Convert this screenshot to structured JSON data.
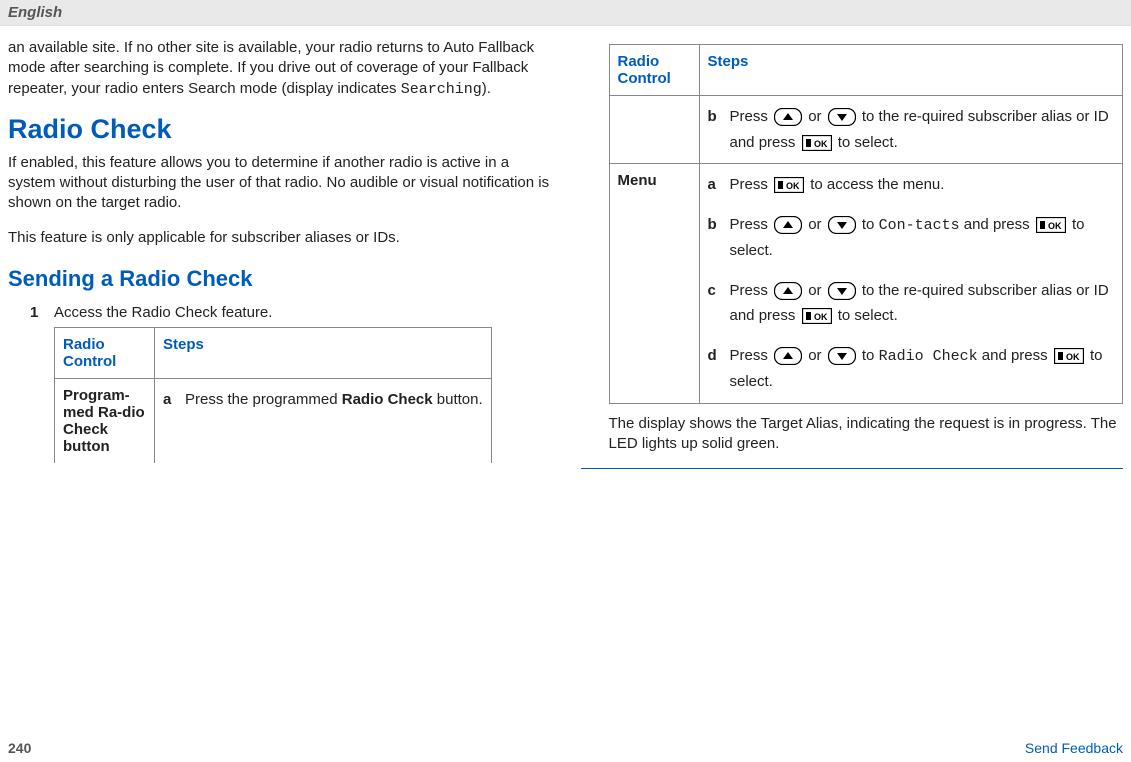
{
  "header": {
    "language": "English"
  },
  "colLeft": {
    "introPara": "an available site. If no other site is available, your radio returns to Auto Fallback mode after searching is complete. If you drive out of coverage of your Fallback repeater, your radio enters Search mode (display indicates ",
    "introMono": "Searching",
    "introClose": ").",
    "h1": "Radio Check",
    "para1": "If enabled, this feature allows you to determine if another radio is active in a system without disturbing the user of that radio. No audible or visual notification is shown on the target radio.",
    "para2": "This feature is only applicable for subscriber aliases or IDs.",
    "h2": "Sending a Radio Check",
    "step1": {
      "num": "1",
      "text": "Access the Radio Check feature."
    },
    "table": {
      "hdr1": "Radio Control",
      "hdr2": "Steps",
      "row1": {
        "label": "Program-med Ra-dio Check button",
        "a": {
          "letter": "a",
          "pre": "Press the programmed ",
          "bold": "Radio Check",
          "post": " button."
        }
      }
    }
  },
  "colRight": {
    "table": {
      "hdr1": "Radio Control",
      "hdr2": "Steps",
      "row0": {
        "b": {
          "letter": "b",
          "pre": "Press ",
          "mid1": " or ",
          "mid2": " to the re-quired subscriber alias or ID and press ",
          "post": " to select."
        }
      },
      "row1": {
        "label": "Menu",
        "a": {
          "letter": "a",
          "pre": "Press ",
          "post": " to access the menu."
        },
        "b": {
          "letter": "b",
          "pre": "Press ",
          "mid": " or ",
          "to": " to ",
          "mono": "Con-tacts",
          "and": " and press ",
          "post": " to select."
        },
        "c": {
          "letter": "c",
          "pre": "Press ",
          "mid": " or ",
          "mid2": " to the re-quired subscriber alias or ID and press ",
          "post": " to select."
        },
        "d": {
          "letter": "d",
          "pre": "Press ",
          "mid": " or ",
          "to": " to ",
          "mono": "Radio Check",
          "and": " and press ",
          "post": " to select."
        }
      }
    },
    "afterTable": "The display shows the Target Alias, indicating the request is in progress. The LED lights up solid green."
  },
  "footer": {
    "page": "240",
    "feedback": "Send Feedback"
  },
  "icons": {
    "up": "up-arrow-button-icon",
    "down": "down-arrow-button-icon",
    "ok": "ok-button-icon"
  }
}
